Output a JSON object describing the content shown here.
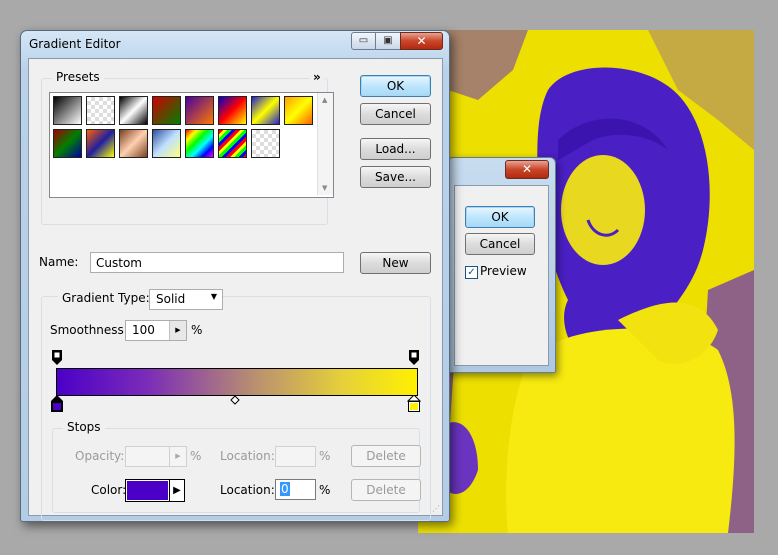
{
  "window": {
    "title": "Gradient Editor"
  },
  "titlebar": {
    "minimize": "▭",
    "maximize": "▣",
    "close": "✕"
  },
  "presets": {
    "label": "Presets",
    "menu_glyph": "»"
  },
  "buttons": {
    "ok": "OK",
    "cancel": "Cancel",
    "load": "Load...",
    "save": "Save...",
    "new": "New",
    "delete": "Delete"
  },
  "name": {
    "label": "Name:",
    "value": "Custom"
  },
  "gradient_type": {
    "label": "Gradient Type:",
    "value": "Solid"
  },
  "smoothness": {
    "label": "Smoothness:",
    "value": "100",
    "unit": "%"
  },
  "stops": {
    "label": "Stops",
    "opacity_label": "Opacity:",
    "opacity_value": "",
    "location_label": "Location:",
    "percent": "%",
    "color_label": "Color:",
    "color_location_value": "0"
  },
  "colors": {
    "start": "#4b00c8",
    "end": "#fff000",
    "photo_fg": "#5a1fd0",
    "photo_bg": "#ede000"
  },
  "preset_swatches": [
    "linear-gradient(135deg,#000,#fff)",
    "repeating-conic-gradient(#ddd 0 25%,#fff 0 50%) 0 0/8px 8px",
    "linear-gradient(135deg,#000,#fff,#000)",
    "linear-gradient(135deg,#d00000,#008000)",
    "linear-gradient(135deg,#4a00a0,#ff7a00)",
    "linear-gradient(135deg,#0000d0,#ff0000,#ffff00)",
    "linear-gradient(135deg,#2020d0,#ffff00,#2020d0)",
    "linear-gradient(135deg,#ffa000,#ffff00,#ff6000)",
    "linear-gradient(135deg,#a00000,#008000,#0000a0)",
    "linear-gradient(135deg,#ff6000,#2020a0,#ffff00)",
    "linear-gradient(135deg,#7a4020,#ffd0b0,#7a4020)",
    "linear-gradient(135deg,#3050a0,#c0e0ff,#ffff80)",
    "linear-gradient(135deg,#ff0000,#ffff00,#00ff00,#00ffff,#0000ff,#ff00ff)",
    "repeating-linear-gradient(135deg,#ff0000 0 3px,#ffff00 3px 6px,#00ff00 6px 9px,#0000ff 9px 12px)",
    "repeating-conic-gradient(#ddd 0 25%,#fff 0 50%) 0 0/8px 8px"
  ],
  "gradient_map_dialog": {
    "ok": "OK",
    "cancel": "Cancel",
    "preview_label": "Preview",
    "preview_checked": true
  }
}
